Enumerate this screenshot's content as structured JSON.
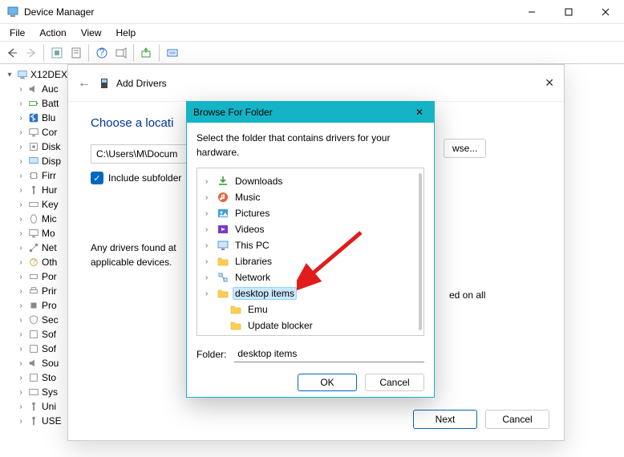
{
  "window": {
    "title": "Device Manager"
  },
  "menu": {
    "file": "File",
    "action": "Action",
    "view": "View",
    "help": "Help"
  },
  "tree": {
    "root": "X12DEX",
    "items": [
      {
        "label": "Auc",
        "icon": "speaker"
      },
      {
        "label": "Batt",
        "icon": "battery"
      },
      {
        "label": "Blu",
        "icon": "bluetooth"
      },
      {
        "label": "Cor",
        "icon": "monitor"
      },
      {
        "label": "Disk",
        "icon": "disk"
      },
      {
        "label": "Disp",
        "icon": "display"
      },
      {
        "label": "Firr",
        "icon": "chip"
      },
      {
        "label": "Hur",
        "icon": "usb"
      },
      {
        "label": "Key",
        "icon": "keyboard"
      },
      {
        "label": "Mic",
        "icon": "mouse"
      },
      {
        "label": "Mo",
        "icon": "monitor"
      },
      {
        "label": "Net",
        "icon": "network"
      },
      {
        "label": "Oth",
        "icon": "other"
      },
      {
        "label": "Por",
        "icon": "port"
      },
      {
        "label": "Prir",
        "icon": "printer"
      },
      {
        "label": "Pro",
        "icon": "cpu"
      },
      {
        "label": "Sec",
        "icon": "security"
      },
      {
        "label": "Sof",
        "icon": "soft"
      },
      {
        "label": "Sof",
        "icon": "soft"
      },
      {
        "label": "Sou",
        "icon": "sound"
      },
      {
        "label": "Sto",
        "icon": "storage"
      },
      {
        "label": "Sys",
        "icon": "system"
      },
      {
        "label": "Uni",
        "icon": "usb"
      },
      {
        "label": "USE",
        "icon": "usb"
      }
    ]
  },
  "wizard": {
    "title": "Add Drivers",
    "heading": "Choose a locati",
    "path": "C:\\Users\\M\\Docum",
    "browse": "wse...",
    "include": "Include subfolder",
    "note1": "Any drivers found at",
    "note2": "applicable devices.",
    "note_tail": "ed on all",
    "next": "Next",
    "cancel": "Cancel"
  },
  "dialog": {
    "title": "Browse For Folder",
    "msg": "Select the folder that contains drivers for your hardware.",
    "items": [
      {
        "label": "Downloads",
        "icon": "download",
        "depth": 0
      },
      {
        "label": "Music",
        "icon": "music",
        "depth": 0
      },
      {
        "label": "Pictures",
        "icon": "pictures",
        "depth": 0
      },
      {
        "label": "Videos",
        "icon": "videos",
        "depth": 0
      },
      {
        "label": "This PC",
        "icon": "pc",
        "depth": 0
      },
      {
        "label": "Libraries",
        "icon": "folder",
        "depth": 0
      },
      {
        "label": "Network",
        "icon": "network",
        "depth": 0
      },
      {
        "label": "desktop items",
        "icon": "folder",
        "depth": 0,
        "selected": true
      },
      {
        "label": "Emu",
        "icon": "folder",
        "depth": 1
      },
      {
        "label": "Update blocker",
        "icon": "folder",
        "depth": 1
      }
    ],
    "folder_label": "Folder:",
    "folder_value": "desktop items",
    "ok": "OK",
    "cancel": "Cancel"
  }
}
